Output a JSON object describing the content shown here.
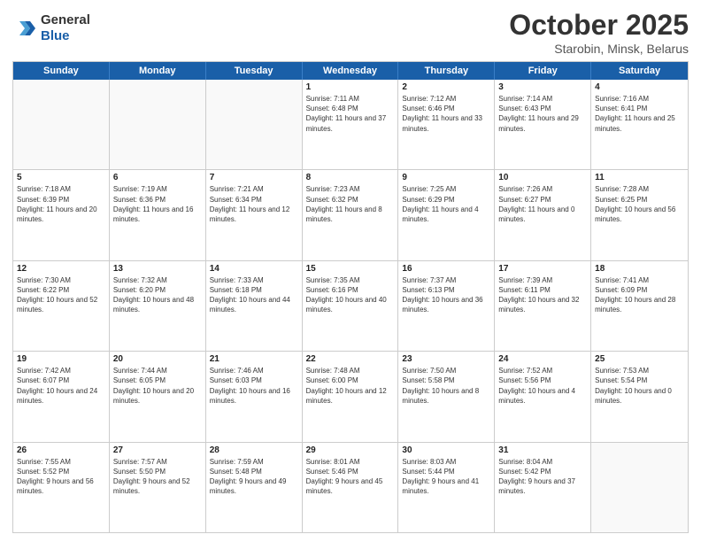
{
  "header": {
    "logo_line1": "General",
    "logo_line2": "Blue",
    "month_title": "October 2025",
    "location": "Starobin, Minsk, Belarus"
  },
  "days_of_week": [
    "Sunday",
    "Monday",
    "Tuesday",
    "Wednesday",
    "Thursday",
    "Friday",
    "Saturday"
  ],
  "weeks": [
    [
      {
        "date": "",
        "info": ""
      },
      {
        "date": "",
        "info": ""
      },
      {
        "date": "",
        "info": ""
      },
      {
        "date": "1",
        "info": "Sunrise: 7:11 AM\nSunset: 6:48 PM\nDaylight: 11 hours and 37 minutes."
      },
      {
        "date": "2",
        "info": "Sunrise: 7:12 AM\nSunset: 6:46 PM\nDaylight: 11 hours and 33 minutes."
      },
      {
        "date": "3",
        "info": "Sunrise: 7:14 AM\nSunset: 6:43 PM\nDaylight: 11 hours and 29 minutes."
      },
      {
        "date": "4",
        "info": "Sunrise: 7:16 AM\nSunset: 6:41 PM\nDaylight: 11 hours and 25 minutes."
      }
    ],
    [
      {
        "date": "5",
        "info": "Sunrise: 7:18 AM\nSunset: 6:39 PM\nDaylight: 11 hours and 20 minutes."
      },
      {
        "date": "6",
        "info": "Sunrise: 7:19 AM\nSunset: 6:36 PM\nDaylight: 11 hours and 16 minutes."
      },
      {
        "date": "7",
        "info": "Sunrise: 7:21 AM\nSunset: 6:34 PM\nDaylight: 11 hours and 12 minutes."
      },
      {
        "date": "8",
        "info": "Sunrise: 7:23 AM\nSunset: 6:32 PM\nDaylight: 11 hours and 8 minutes."
      },
      {
        "date": "9",
        "info": "Sunrise: 7:25 AM\nSunset: 6:29 PM\nDaylight: 11 hours and 4 minutes."
      },
      {
        "date": "10",
        "info": "Sunrise: 7:26 AM\nSunset: 6:27 PM\nDaylight: 11 hours and 0 minutes."
      },
      {
        "date": "11",
        "info": "Sunrise: 7:28 AM\nSunset: 6:25 PM\nDaylight: 10 hours and 56 minutes."
      }
    ],
    [
      {
        "date": "12",
        "info": "Sunrise: 7:30 AM\nSunset: 6:22 PM\nDaylight: 10 hours and 52 minutes."
      },
      {
        "date": "13",
        "info": "Sunrise: 7:32 AM\nSunset: 6:20 PM\nDaylight: 10 hours and 48 minutes."
      },
      {
        "date": "14",
        "info": "Sunrise: 7:33 AM\nSunset: 6:18 PM\nDaylight: 10 hours and 44 minutes."
      },
      {
        "date": "15",
        "info": "Sunrise: 7:35 AM\nSunset: 6:16 PM\nDaylight: 10 hours and 40 minutes."
      },
      {
        "date": "16",
        "info": "Sunrise: 7:37 AM\nSunset: 6:13 PM\nDaylight: 10 hours and 36 minutes."
      },
      {
        "date": "17",
        "info": "Sunrise: 7:39 AM\nSunset: 6:11 PM\nDaylight: 10 hours and 32 minutes."
      },
      {
        "date": "18",
        "info": "Sunrise: 7:41 AM\nSunset: 6:09 PM\nDaylight: 10 hours and 28 minutes."
      }
    ],
    [
      {
        "date": "19",
        "info": "Sunrise: 7:42 AM\nSunset: 6:07 PM\nDaylight: 10 hours and 24 minutes."
      },
      {
        "date": "20",
        "info": "Sunrise: 7:44 AM\nSunset: 6:05 PM\nDaylight: 10 hours and 20 minutes."
      },
      {
        "date": "21",
        "info": "Sunrise: 7:46 AM\nSunset: 6:03 PM\nDaylight: 10 hours and 16 minutes."
      },
      {
        "date": "22",
        "info": "Sunrise: 7:48 AM\nSunset: 6:00 PM\nDaylight: 10 hours and 12 minutes."
      },
      {
        "date": "23",
        "info": "Sunrise: 7:50 AM\nSunset: 5:58 PM\nDaylight: 10 hours and 8 minutes."
      },
      {
        "date": "24",
        "info": "Sunrise: 7:52 AM\nSunset: 5:56 PM\nDaylight: 10 hours and 4 minutes."
      },
      {
        "date": "25",
        "info": "Sunrise: 7:53 AM\nSunset: 5:54 PM\nDaylight: 10 hours and 0 minutes."
      }
    ],
    [
      {
        "date": "26",
        "info": "Sunrise: 7:55 AM\nSunset: 5:52 PM\nDaylight: 9 hours and 56 minutes."
      },
      {
        "date": "27",
        "info": "Sunrise: 7:57 AM\nSunset: 5:50 PM\nDaylight: 9 hours and 52 minutes."
      },
      {
        "date": "28",
        "info": "Sunrise: 7:59 AM\nSunset: 5:48 PM\nDaylight: 9 hours and 49 minutes."
      },
      {
        "date": "29",
        "info": "Sunrise: 8:01 AM\nSunset: 5:46 PM\nDaylight: 9 hours and 45 minutes."
      },
      {
        "date": "30",
        "info": "Sunrise: 8:03 AM\nSunset: 5:44 PM\nDaylight: 9 hours and 41 minutes."
      },
      {
        "date": "31",
        "info": "Sunrise: 8:04 AM\nSunset: 5:42 PM\nDaylight: 9 hours and 37 minutes."
      },
      {
        "date": "",
        "info": ""
      }
    ]
  ]
}
